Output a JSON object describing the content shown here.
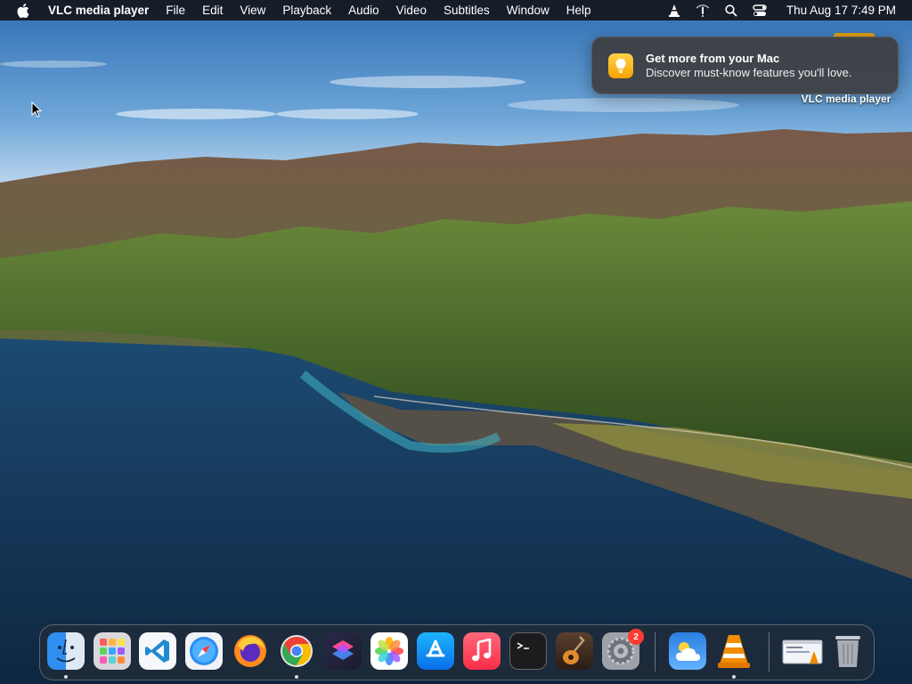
{
  "menubar": {
    "app_name": "VLC media player",
    "items": [
      "File",
      "Edit",
      "View",
      "Playback",
      "Audio",
      "Video",
      "Subtitles",
      "Window",
      "Help"
    ],
    "clock": "Thu Aug 17  7:49 PM"
  },
  "notification": {
    "title": "Get more from your Mac",
    "body": "Discover must-know features you'll love."
  },
  "desktop": {
    "label": "VLC media player"
  },
  "dock": {
    "apps": [
      "Finder",
      "Launchpad",
      "Visual Studio Code",
      "Safari",
      "Firefox",
      "Google Chrome",
      "Shortcuts",
      "Photos",
      "App Store",
      "Music",
      "Terminal",
      "GarageBand",
      "System Settings",
      "Weather",
      "VLC",
      "Downloads",
      "Trash"
    ],
    "settings_badge": "2"
  },
  "colors": {
    "menubar_bg": "#15171c",
    "notification_bg": "#3e3e40",
    "badge": "#ff3b30",
    "vlc_orange": "#f28c00"
  }
}
